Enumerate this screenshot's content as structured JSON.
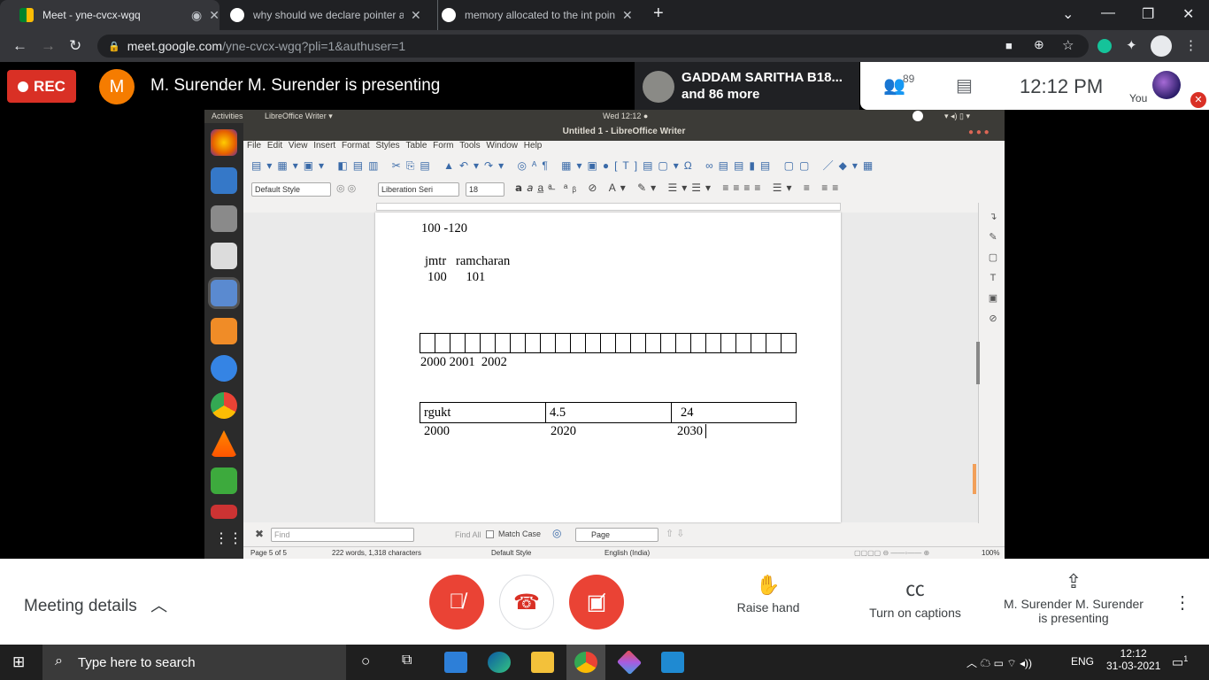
{
  "tabs": [
    {
      "title": "Meet - yne-cvcx-wgq",
      "active": true
    },
    {
      "title": "why should we declare pointer a"
    },
    {
      "title": "memory allocated to the int poin"
    }
  ],
  "address": {
    "host": "meet.google.com",
    "path": "/yne-cvcx-wgq?pli=1&authuser=1"
  },
  "meet_header": {
    "rec_label": "REC",
    "presenter_initial": "M",
    "presenting_text": "M. Surender M. Surender is presenting",
    "participant_line1": "GADDAM SARITHA B18...",
    "participant_line2": "and 86 more",
    "people_count": "89",
    "time": "12:12  PM",
    "you_label": "You"
  },
  "ubuntu": {
    "activities": "Activities",
    "app_menu": "LibreOffice Writer ▾",
    "clock": "Wed 12:12 ●"
  },
  "writer": {
    "window_title": "Untitled 1 - LibreOffice Writer",
    "menu": [
      "File",
      "Edit",
      "View",
      "Insert",
      "Format",
      "Styles",
      "Table",
      "Form",
      "Tools",
      "Window",
      "Help"
    ],
    "style": "Default Style",
    "font": "Liberation Seri",
    "size": "18",
    "doc": {
      "line1": "100 -120",
      "line2": "jmtr   ramcharan",
      "line3": "100      101",
      "cells": [
        "2000 2001  2002"
      ],
      "table": [
        "rgukt",
        "4.5",
        "24"
      ],
      "addr": [
        "2000",
        "2020",
        "2030"
      ]
    },
    "find": {
      "placeholder": "Find",
      "find_all": "Find All",
      "match_case": "Match Case",
      "page": "Page"
    },
    "status": {
      "page": "Page 5 of 5",
      "words": "222 words, 1,318 characters",
      "style": "Default Style",
      "lang": "English (India)",
      "zoom": "100%"
    }
  },
  "meet_bottom": {
    "details": "Meeting details",
    "raise": "Raise hand",
    "captions": "Turn on captions",
    "presenting1": "M. Surender M. Surender",
    "presenting2": "is presenting"
  },
  "taskbar": {
    "search": "Type here to search",
    "lang": "ENG",
    "time": "12:12",
    "date": "31-03-2021",
    "notif": "1"
  }
}
